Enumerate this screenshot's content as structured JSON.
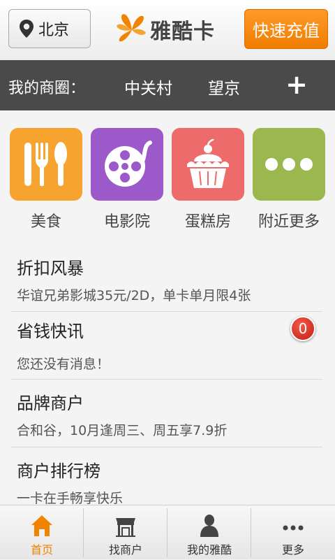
{
  "header": {
    "city": "北京",
    "logo_text": "雅酷卡",
    "recharge_label": "快速充值"
  },
  "business_circle": {
    "label": "我的商圈：",
    "areas": [
      "中关村",
      "望京"
    ],
    "add_symbol": "+"
  },
  "categories": [
    {
      "label": "美食",
      "color": "#f7a32f",
      "icon": "cutlery-icon"
    },
    {
      "label": "电影院",
      "color": "#9b59c9",
      "icon": "film-reel-icon"
    },
    {
      "label": "蛋糕房",
      "color": "#ee6b6b",
      "icon": "cake-icon"
    },
    {
      "label": "附近更多",
      "color": "#9ab84e",
      "icon": "more-dots-icon"
    }
  ],
  "list": [
    {
      "title": "折扣风暴",
      "subtitle": "华谊兄弟影城35元/2D，单卡单月限4张"
    },
    {
      "title": "省钱快讯",
      "subtitle": "您还没有消息！",
      "badge": "0"
    },
    {
      "title": "品牌商户",
      "subtitle": "合和谷，10月逢周三、周五享7.9折"
    },
    {
      "title": "商户排行榜",
      "subtitle": "一卡在手畅享快乐"
    }
  ],
  "nav": [
    {
      "label": "首页",
      "icon": "home-icon",
      "active": true
    },
    {
      "label": "找商户",
      "icon": "storefront-icon",
      "active": false
    },
    {
      "label": "我的雅酷",
      "icon": "user-icon",
      "active": false
    },
    {
      "label": "更多",
      "icon": "more-dots-icon",
      "active": false
    }
  ],
  "colors": {
    "accent": "#f08300",
    "bar": "#4a4a4a",
    "badge": "#d42a1c"
  }
}
